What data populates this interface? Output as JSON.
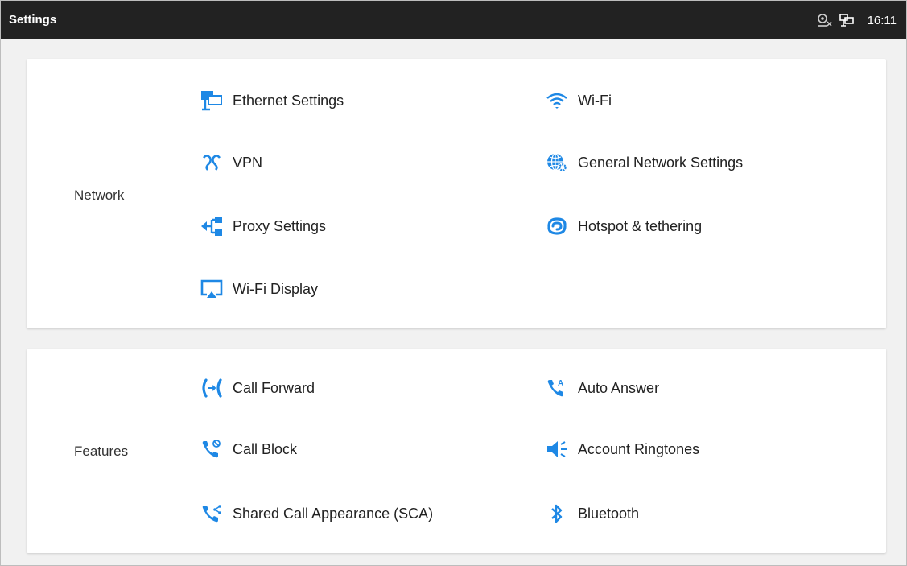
{
  "statusbar": {
    "title": "Settings",
    "time": "16:11",
    "icons": [
      "network-disconnected-icon",
      "ethernet-icon"
    ]
  },
  "network": {
    "label": "Network",
    "items": [
      {
        "label": "Ethernet Settings",
        "icon": "ethernet-icon"
      },
      {
        "label": "Wi-Fi",
        "icon": "wifi-icon"
      },
      {
        "label": "VPN",
        "icon": "vpn-icon"
      },
      {
        "label": "General Network Settings",
        "icon": "globe-gear-icon"
      },
      {
        "label": "Proxy Settings",
        "icon": "proxy-icon"
      },
      {
        "label": "Hotspot & tethering",
        "icon": "hotspot-icon"
      },
      {
        "label": "Wi-Fi Display",
        "icon": "cast-icon"
      }
    ]
  },
  "features": {
    "label": "Features",
    "items": [
      {
        "label": "Call Forward",
        "icon": "call-forward-icon"
      },
      {
        "label": "Auto Answer",
        "icon": "auto-answer-icon"
      },
      {
        "label": "Call Block",
        "icon": "call-block-icon"
      },
      {
        "label": "Account Ringtones",
        "icon": "speaker-icon"
      },
      {
        "label": "Shared Call Appearance (SCA)",
        "icon": "shared-call-icon"
      },
      {
        "label": "Bluetooth",
        "icon": "bluetooth-icon"
      }
    ]
  },
  "colors": {
    "accent": "#1e88e5",
    "statusbar": "#222222",
    "background": "#f1f1f1"
  }
}
